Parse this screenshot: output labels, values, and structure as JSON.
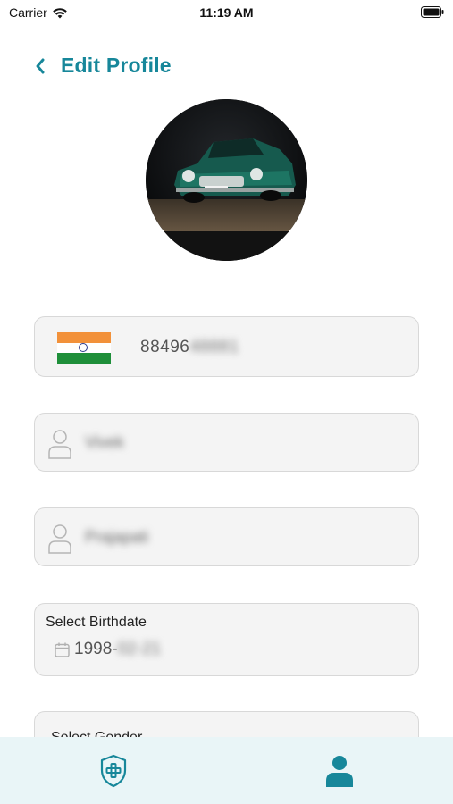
{
  "status_bar": {
    "carrier": "Carrier",
    "time": "11:19 AM"
  },
  "header": {
    "back_icon": "chevron-left-icon",
    "title": "Edit Profile"
  },
  "profile": {
    "avatar": "avatar-image-green-classic-car"
  },
  "phone": {
    "country_flag": "india-flag-icon",
    "number_visible": "88496",
    "number_hidden": "48881"
  },
  "first_name": {
    "value": "Vivek",
    "icon": "person-icon"
  },
  "last_name": {
    "value": "Prajapati",
    "icon": "person-icon"
  },
  "birthdate": {
    "label": "Select Birthdate",
    "icon": "calendar-icon",
    "value_visible": "1998-",
    "value_hidden": "02-21"
  },
  "gender": {
    "label": "Select Gender"
  },
  "tab_bar": {
    "items": [
      {
        "icon": "shield-plus-icon"
      },
      {
        "icon": "user-icon"
      }
    ]
  },
  "colors": {
    "accent": "#17879a",
    "tab_bar_bg": "#e9f5f7",
    "field_bg": "#f4f4f4"
  }
}
